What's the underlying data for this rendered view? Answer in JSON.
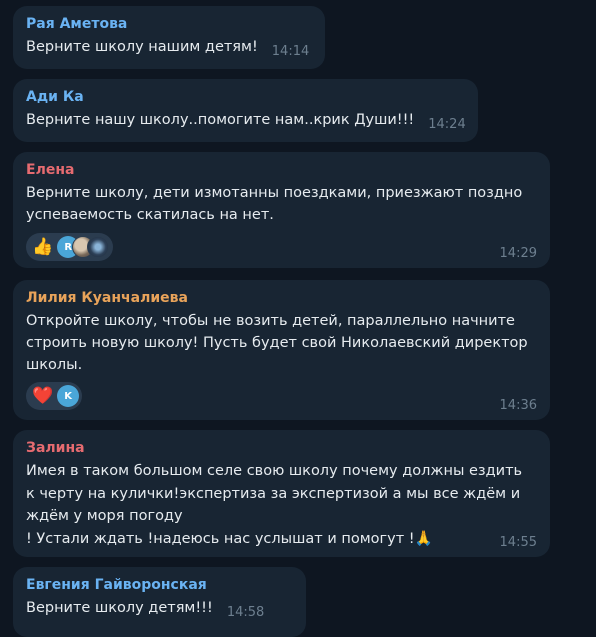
{
  "messages": [
    {
      "author": "Рая Аметова",
      "author_color": "#6ab3f3",
      "text": "Верните школу нашим детям!",
      "time": "14:14"
    },
    {
      "author": "Ади Ка",
      "author_color": "#6ab3f3",
      "text": "Верните нашу школу..помогите нам..крик Души!!!",
      "time": "14:24"
    },
    {
      "author": "Елена",
      "author_color": "#e66b70",
      "lines": [
        "Верните школу, дети измотанны поездками, приезжают поздно",
        "успеваемость скатилась на нет."
      ],
      "time": "14:29",
      "reaction_emoji": "👍",
      "reactor_initial": "R",
      "reactor_color": "#4aa6d8"
    },
    {
      "author": "Лилия Куанчалиева",
      "author_color": "#e8a35a",
      "lines": [
        "Откройте школу, чтобы не возить детей, параллельно начните",
        "строить новую школу! Пусть будет свой Николаевский директор",
        "школы."
      ],
      "time": "14:36",
      "reaction_emoji": "❤️",
      "reactor_initial": "K",
      "reactor_color": "#4aa6d8"
    },
    {
      "author": "Залина",
      "author_color": "#e66b70",
      "lines": [
        "Имея в таком большом селе свою школу почему должны ездить",
        "к черту на кулички!экспертиза за экспертизой а мы все ждём и",
        "ждём у моря погоду",
        "! Устали ждать !надеюсь нас услышат и помогут !🙏"
      ],
      "time": "14:55"
    },
    {
      "author": "Евгения Гайворонская",
      "author_color": "#6ab3f3",
      "text": "Верните школу детям!!!",
      "time": "14:58"
    }
  ]
}
